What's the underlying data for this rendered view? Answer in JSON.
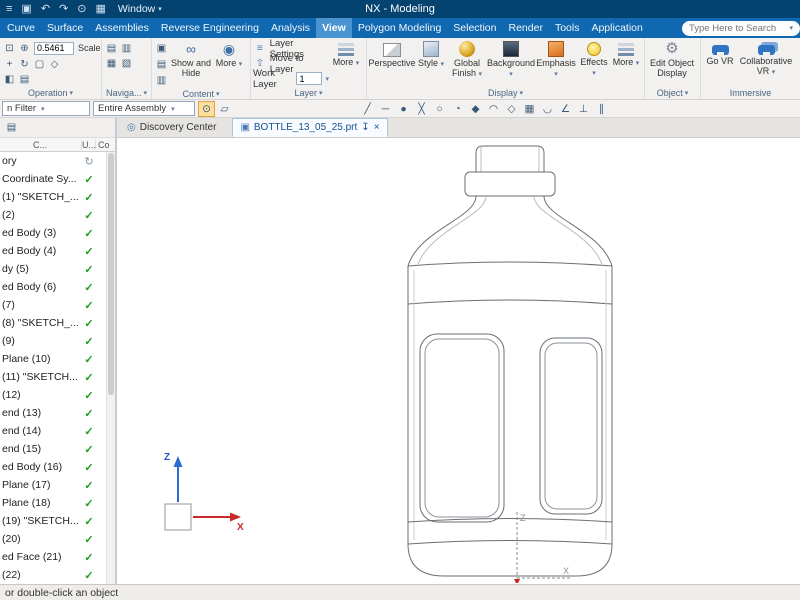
{
  "ui": {
    "caret": "▾"
  },
  "titlebar": {
    "title": "NX - Modeling",
    "window_label": "Window",
    "icons": [
      {
        "name": "app-menu-icon",
        "glyph": "≡"
      },
      {
        "name": "save-icon",
        "glyph": "▣"
      },
      {
        "name": "undo-icon",
        "glyph": "↶"
      },
      {
        "name": "redo-icon",
        "glyph": "↷"
      },
      {
        "name": "mic-icon",
        "glyph": "⊙"
      },
      {
        "name": "window-layout-icon",
        "glyph": "▦"
      }
    ]
  },
  "ribbon_tabs": {
    "search_placeholder": "Type Here to Search",
    "tabs": [
      {
        "label": "Curve",
        "name": "tab-curve"
      },
      {
        "label": "Surface",
        "name": "tab-surface"
      },
      {
        "label": "Assemblies",
        "name": "tab-assemblies"
      },
      {
        "label": "Reverse Engineering",
        "name": "tab-reverse-engineering"
      },
      {
        "label": "Analysis",
        "name": "tab-analysis"
      },
      {
        "label": "View",
        "name": "tab-view",
        "active": true
      },
      {
        "label": "Polygon Modeling",
        "name": "tab-polygon-modeling"
      },
      {
        "label": "Selection",
        "name": "tab-selection"
      },
      {
        "label": "Render",
        "name": "tab-render"
      },
      {
        "label": "Tools",
        "name": "tab-tools"
      },
      {
        "label": "Application",
        "name": "tab-application"
      }
    ]
  },
  "ribbon": {
    "operation": {
      "group_label": "Operation",
      "scale_value": "0.5461",
      "scale_label": "Scale",
      "icons_top": [
        {
          "name": "fit-view-icon",
          "glyph": "⊡"
        },
        {
          "name": "zoom-icon",
          "glyph": "⊕"
        }
      ],
      "icons_grid": [
        {
          "name": "pan-icon",
          "glyph": "+"
        },
        {
          "name": "rotate-icon",
          "glyph": "↻"
        },
        {
          "name": "front-view-icon",
          "glyph": "▢"
        },
        {
          "name": "trimetric-view-icon",
          "glyph": "◇"
        },
        {
          "name": "section-view-icon",
          "glyph": "◧"
        },
        {
          "name": "snapshot-icon",
          "glyph": "▤"
        }
      ]
    },
    "navigation": {
      "group_label": "Naviga...",
      "icons": [
        {
          "name": "tile-windows-icon",
          "glyph": "▤"
        },
        {
          "name": "cascade-windows-icon",
          "glyph": "▥"
        },
        {
          "name": "split-window-icon",
          "glyph": "▦"
        },
        {
          "name": "new-window-icon",
          "glyph": "▧"
        }
      ]
    },
    "content": {
      "group_label": "Content",
      "show_and_hide": "Show and Hide",
      "show_hide_glyph": "∞",
      "more": "More",
      "more_glyph": "◉",
      "icons": [
        {
          "name": "show-icon",
          "glyph": "▣"
        },
        {
          "name": "hide-icon",
          "glyph": "▤"
        },
        {
          "name": "invert-shown-icon",
          "glyph": "▥"
        }
      ]
    },
    "layer": {
      "group_label": "Layer",
      "layer_settings": "Layer Settings",
      "settings_glyph": "≡",
      "move_to_layer": "Move to Layer",
      "move_glyph": "⇧",
      "work_layer": "Work Layer",
      "work_layer_value": "1",
      "more": "More"
    },
    "display": {
      "group_label": "Display",
      "buttons": [
        {
          "label": "Perspective"
        },
        {
          "label": "Style",
          "caret": "▾"
        },
        {
          "label": "Global Finish",
          "caret": "▾"
        },
        {
          "label": "Background",
          "caret": "▾"
        },
        {
          "label": "Emphasis",
          "caret": "▾"
        },
        {
          "label": "Effects",
          "caret": "▾"
        },
        {
          "label": "More",
          "caret": "▾"
        }
      ]
    },
    "object": {
      "group_label": "Object",
      "edit_object_display": "Edit Object Display",
      "gear_glyph": "⚙"
    },
    "immersive": {
      "group_label": "Immersive",
      "go_vr": "Go VR",
      "collaborative_vr": "Collaborative VR"
    }
  },
  "toolbar": {
    "selection_filter": "n Filter",
    "scope": "Entire Assembly",
    "icons_a": [
      {
        "name": "snap-point-icon",
        "glyph": "⊙",
        "active": true
      },
      {
        "name": "design-in-context-icon",
        "glyph": "▱"
      }
    ],
    "icons_b": [
      {
        "name": "endpoint-icon",
        "glyph": "╱"
      },
      {
        "name": "midpoint-icon",
        "glyph": "─"
      },
      {
        "name": "control-point-icon",
        "glyph": "●"
      },
      {
        "name": "intersection-icon",
        "glyph": "╳"
      },
      {
        "name": "arc-center-icon",
        "glyph": "○"
      },
      {
        "name": "quadrant-point-icon",
        "glyph": "◔"
      },
      {
        "name": "existing-point-icon",
        "glyph": "◆"
      },
      {
        "name": "point-on-curve-icon",
        "glyph": "◠"
      },
      {
        "name": "point-on-surface-icon",
        "glyph": "◇"
      },
      {
        "name": "bounded-grid-icon",
        "glyph": "▦"
      },
      {
        "name": "tangent-point-icon",
        "glyph": "◡"
      },
      {
        "name": "angle-icon",
        "glyph": "∠"
      },
      {
        "name": "perpendicular-icon",
        "glyph": "⊥"
      },
      {
        "name": "parallel-icon",
        "glyph": "∥"
      }
    ]
  },
  "docbar": {
    "tabs": [
      {
        "label": "Discovery Center",
        "name": "tab-discovery-center",
        "icon": "◎"
      },
      {
        "label": "BOTTLE_13_05_25.prt",
        "name": "tab-bottle-part",
        "icon": "▣",
        "active": true,
        "pin": "↧",
        "close": "×"
      }
    ]
  },
  "navigator": {
    "toolbar_icon_glyph": "▤",
    "columns": {
      "name": "C...",
      "up_to_date": "U...",
      "comment": "Co"
    },
    "rows": [
      {
        "label": "ory",
        "status": "↻"
      },
      {
        "label": "Coordinate Sy...",
        "status": "✓"
      },
      {
        "label": "(1) \"SKETCH_...",
        "status": "✓"
      },
      {
        "label": "(2)",
        "status": "✓"
      },
      {
        "label": "ed Body (3)",
        "status": "✓"
      },
      {
        "label": "ed Body (4)",
        "status": "✓"
      },
      {
        "label": "dy (5)",
        "status": "✓"
      },
      {
        "label": "ed Body (6)",
        "status": "✓"
      },
      {
        "label": "(7)",
        "status": "✓"
      },
      {
        "label": "(8) \"SKETCH_...",
        "status": "✓"
      },
      {
        "label": "(9)",
        "status": "✓"
      },
      {
        "label": "Plane (10)",
        "status": "✓"
      },
      {
        "label": "(11) \"SKETCH...",
        "status": "✓"
      },
      {
        "label": "(12)",
        "status": "✓"
      },
      {
        "label": "end (13)",
        "status": "✓"
      },
      {
        "label": "end (14)",
        "status": "✓"
      },
      {
        "label": "end (15)",
        "status": "✓"
      },
      {
        "label": "ed Body (16)",
        "status": "✓"
      },
      {
        "label": "Plane (17)",
        "status": "✓"
      },
      {
        "label": "Plane (18)",
        "status": "✓"
      },
      {
        "label": "(19) \"SKETCH...",
        "status": "✓"
      },
      {
        "label": "(20)",
        "status": "✓"
      },
      {
        "label": "ed Face (21)",
        "status": "✓"
      },
      {
        "label": "(22)",
        "status": "✓"
      }
    ]
  },
  "viewport": {
    "triad": {
      "z_label": "Z",
      "x_label": "X"
    },
    "wcs": {
      "z_label": "Z",
      "x_label": "X"
    }
  },
  "statusbar": {
    "text": "or double-click an object"
  }
}
